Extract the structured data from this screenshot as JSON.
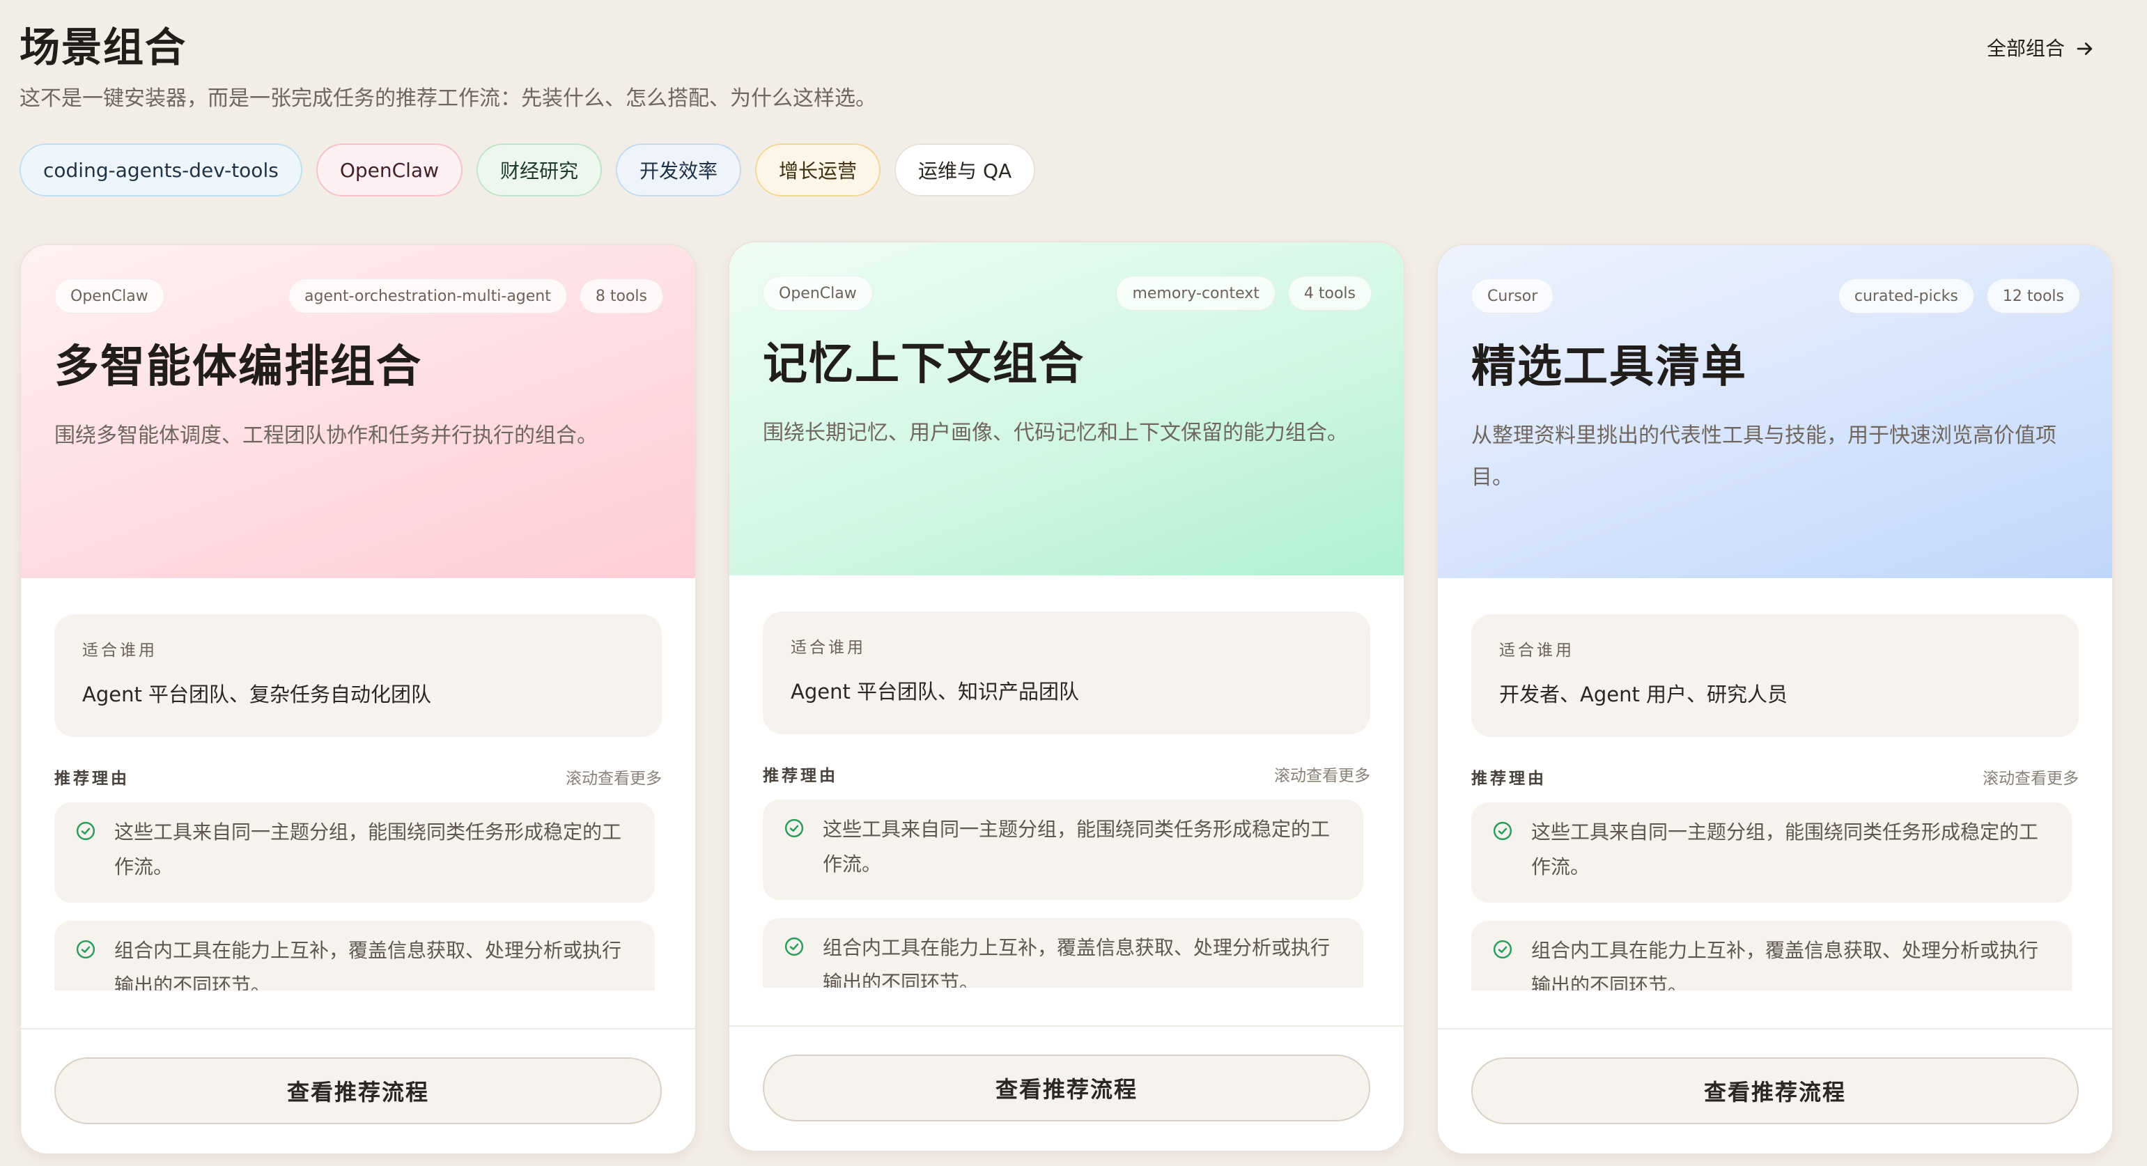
{
  "header": {
    "title": "场景组合",
    "subtitle": "这不是一键安装器，而是一张完成任务的推荐工作流：先装什么、怎么搭配、为什么这样选。",
    "all_link": "全部组合"
  },
  "chips": [
    "coding-agents-dev-tools",
    "OpenClaw",
    "财经研究",
    "开发效率",
    "增长运营",
    "运维与 QA"
  ],
  "labels": {
    "audience": "适合谁用",
    "reasons": "推荐理由",
    "scroll_hint": "滚动查看更多",
    "cta": "查看推荐流程"
  },
  "cards": [
    {
      "platform": "OpenClaw",
      "tag": "agent-orchestration-multi-agent",
      "tools": "8 tools",
      "title": "多智能体编排组合",
      "description": "围绕多智能体调度、工程团队协作和任务并行执行的组合。",
      "audience": "Agent 平台团队、复杂任务自动化团队",
      "reasons": [
        "这些工具来自同一主题分组，能围绕同类任务形成稳定的工作流。",
        "组合内工具在能力上互补，覆盖信息获取、处理分析或执行输出的不同环节。"
      ]
    },
    {
      "platform": "OpenClaw",
      "tag": "memory-context",
      "tools": "4 tools",
      "title": "记忆上下文组合",
      "description": "围绕长期记忆、用户画像、代码记忆和上下文保留的能力组合。",
      "audience": "Agent 平台团队、知识产品团队",
      "reasons": [
        "这些工具来自同一主题分组，能围绕同类任务形成稳定的工作流。",
        "组合内工具在能力上互补，覆盖信息获取、处理分析或执行输出的不同环节。"
      ]
    },
    {
      "platform": "Cursor",
      "tag": "curated-picks",
      "tools": "12 tools",
      "title": "精选工具清单",
      "description": "从整理资料里挑出的代表性工具与技能，用于快速浏览高价值项目。",
      "audience": "开发者、Agent 用户、研究人员",
      "reasons": [
        "这些工具来自同一主题分组，能围绕同类任务形成稳定的工作流。",
        "组合内工具在能力上互补，覆盖信息获取、处理分析或执行输出的不同环节。"
      ]
    }
  ],
  "colors": {
    "background": "#f2ede6",
    "check_green": "#2a9d5c",
    "card_pink": "#ffcdd5",
    "card_green": "#aef0cf",
    "card_blue": "#c0d6fb"
  }
}
